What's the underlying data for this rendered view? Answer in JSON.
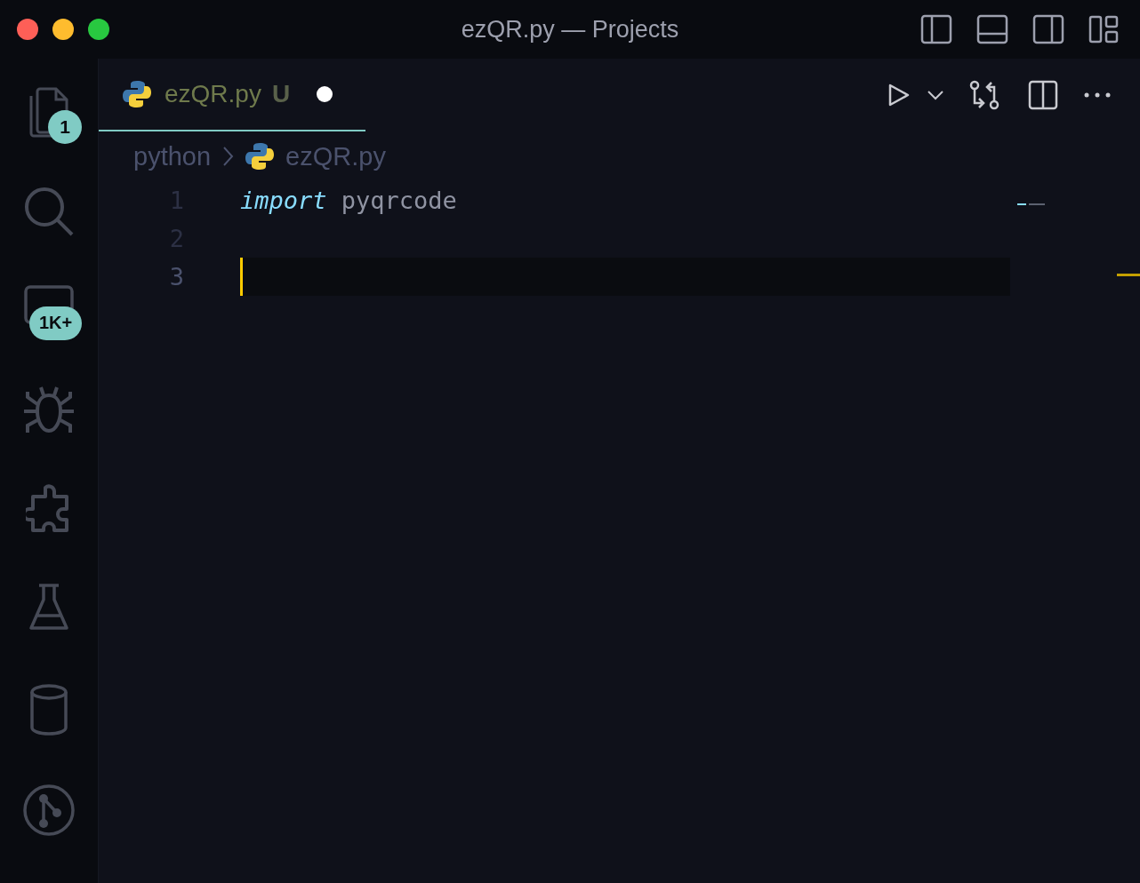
{
  "window": {
    "title": "ezQR.py — Projects"
  },
  "activity_bar": [
    {
      "kind": "files",
      "badge": "1",
      "selected": false
    },
    {
      "kind": "search",
      "selected": false
    },
    {
      "kind": "panel",
      "badge": "1K+",
      "selected": false
    },
    {
      "kind": "debug",
      "selected": false
    },
    {
      "kind": "extensions",
      "selected": false
    },
    {
      "kind": "testing",
      "selected": false
    },
    {
      "kind": "database",
      "selected": false
    },
    {
      "kind": "git",
      "selected": false
    }
  ],
  "tabs": [
    {
      "label": "ezQR.py",
      "status": "U",
      "modified": true,
      "selected": true
    }
  ],
  "breadcrumb": [
    "python",
    "ezQR.py"
  ],
  "editor": {
    "lines": [
      {
        "number": "1",
        "current": false,
        "tokens": [
          {
            "kind": "keyword",
            "text": "import"
          },
          {
            "kind": "name",
            "text": " pyqrcode"
          }
        ]
      },
      {
        "number": "2",
        "current": false
      },
      {
        "number": "3",
        "current": true
      }
    ]
  }
}
